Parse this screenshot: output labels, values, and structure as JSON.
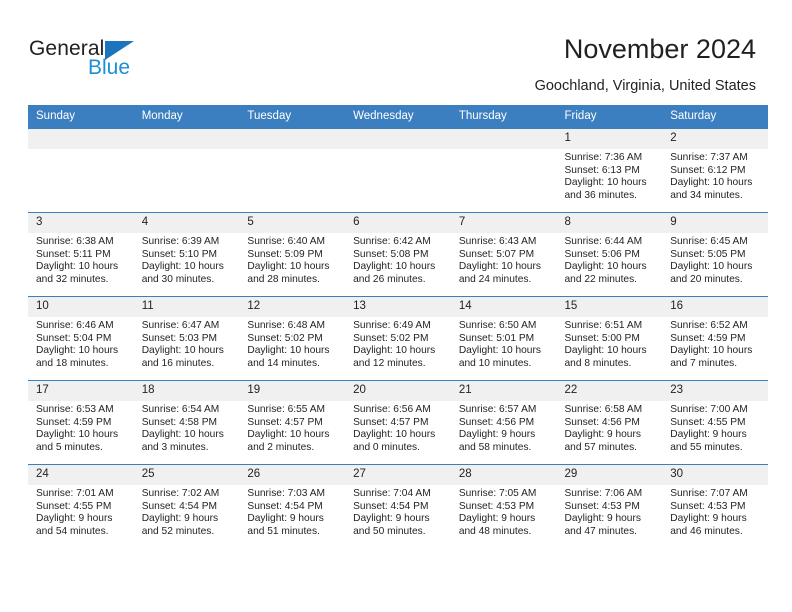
{
  "brand": {
    "name_part1": "General",
    "name_part2": "Blue",
    "triangle_color": "#1c75bc",
    "blue_color": "#1c8fd6"
  },
  "header": {
    "title": "November 2024",
    "subtitle": "Goochland, Virginia, United States",
    "accent_color": "#3c7fc0"
  },
  "calendar": {
    "weekdays": [
      "Sunday",
      "Monday",
      "Tuesday",
      "Wednesday",
      "Thursday",
      "Friday",
      "Saturday"
    ],
    "weeks": [
      [
        {
          "day": "",
          "sunrise": "",
          "sunset": "",
          "daylight": "",
          "blank": true
        },
        {
          "day": "",
          "sunrise": "",
          "sunset": "",
          "daylight": "",
          "blank": true
        },
        {
          "day": "",
          "sunrise": "",
          "sunset": "",
          "daylight": "",
          "blank": true
        },
        {
          "day": "",
          "sunrise": "",
          "sunset": "",
          "daylight": "",
          "blank": true
        },
        {
          "day": "",
          "sunrise": "",
          "sunset": "",
          "daylight": "",
          "blank": true
        },
        {
          "day": "1",
          "sunrise": "Sunrise: 7:36 AM",
          "sunset": "Sunset: 6:13 PM",
          "daylight": "Daylight: 10 hours and 36 minutes."
        },
        {
          "day": "2",
          "sunrise": "Sunrise: 7:37 AM",
          "sunset": "Sunset: 6:12 PM",
          "daylight": "Daylight: 10 hours and 34 minutes."
        }
      ],
      [
        {
          "day": "3",
          "sunrise": "Sunrise: 6:38 AM",
          "sunset": "Sunset: 5:11 PM",
          "daylight": "Daylight: 10 hours and 32 minutes."
        },
        {
          "day": "4",
          "sunrise": "Sunrise: 6:39 AM",
          "sunset": "Sunset: 5:10 PM",
          "daylight": "Daylight: 10 hours and 30 minutes."
        },
        {
          "day": "5",
          "sunrise": "Sunrise: 6:40 AM",
          "sunset": "Sunset: 5:09 PM",
          "daylight": "Daylight: 10 hours and 28 minutes."
        },
        {
          "day": "6",
          "sunrise": "Sunrise: 6:42 AM",
          "sunset": "Sunset: 5:08 PM",
          "daylight": "Daylight: 10 hours and 26 minutes."
        },
        {
          "day": "7",
          "sunrise": "Sunrise: 6:43 AM",
          "sunset": "Sunset: 5:07 PM",
          "daylight": "Daylight: 10 hours and 24 minutes."
        },
        {
          "day": "8",
          "sunrise": "Sunrise: 6:44 AM",
          "sunset": "Sunset: 5:06 PM",
          "daylight": "Daylight: 10 hours and 22 minutes."
        },
        {
          "day": "9",
          "sunrise": "Sunrise: 6:45 AM",
          "sunset": "Sunset: 5:05 PM",
          "daylight": "Daylight: 10 hours and 20 minutes."
        }
      ],
      [
        {
          "day": "10",
          "sunrise": "Sunrise: 6:46 AM",
          "sunset": "Sunset: 5:04 PM",
          "daylight": "Daylight: 10 hours and 18 minutes."
        },
        {
          "day": "11",
          "sunrise": "Sunrise: 6:47 AM",
          "sunset": "Sunset: 5:03 PM",
          "daylight": "Daylight: 10 hours and 16 minutes."
        },
        {
          "day": "12",
          "sunrise": "Sunrise: 6:48 AM",
          "sunset": "Sunset: 5:02 PM",
          "daylight": "Daylight: 10 hours and 14 minutes."
        },
        {
          "day": "13",
          "sunrise": "Sunrise: 6:49 AM",
          "sunset": "Sunset: 5:02 PM",
          "daylight": "Daylight: 10 hours and 12 minutes."
        },
        {
          "day": "14",
          "sunrise": "Sunrise: 6:50 AM",
          "sunset": "Sunset: 5:01 PM",
          "daylight": "Daylight: 10 hours and 10 minutes."
        },
        {
          "day": "15",
          "sunrise": "Sunrise: 6:51 AM",
          "sunset": "Sunset: 5:00 PM",
          "daylight": "Daylight: 10 hours and 8 minutes."
        },
        {
          "day": "16",
          "sunrise": "Sunrise: 6:52 AM",
          "sunset": "Sunset: 4:59 PM",
          "daylight": "Daylight: 10 hours and 7 minutes."
        }
      ],
      [
        {
          "day": "17",
          "sunrise": "Sunrise: 6:53 AM",
          "sunset": "Sunset: 4:59 PM",
          "daylight": "Daylight: 10 hours and 5 minutes."
        },
        {
          "day": "18",
          "sunrise": "Sunrise: 6:54 AM",
          "sunset": "Sunset: 4:58 PM",
          "daylight": "Daylight: 10 hours and 3 minutes."
        },
        {
          "day": "19",
          "sunrise": "Sunrise: 6:55 AM",
          "sunset": "Sunset: 4:57 PM",
          "daylight": "Daylight: 10 hours and 2 minutes."
        },
        {
          "day": "20",
          "sunrise": "Sunrise: 6:56 AM",
          "sunset": "Sunset: 4:57 PM",
          "daylight": "Daylight: 10 hours and 0 minutes."
        },
        {
          "day": "21",
          "sunrise": "Sunrise: 6:57 AM",
          "sunset": "Sunset: 4:56 PM",
          "daylight": "Daylight: 9 hours and 58 minutes."
        },
        {
          "day": "22",
          "sunrise": "Sunrise: 6:58 AM",
          "sunset": "Sunset: 4:56 PM",
          "daylight": "Daylight: 9 hours and 57 minutes."
        },
        {
          "day": "23",
          "sunrise": "Sunrise: 7:00 AM",
          "sunset": "Sunset: 4:55 PM",
          "daylight": "Daylight: 9 hours and 55 minutes."
        }
      ],
      [
        {
          "day": "24",
          "sunrise": "Sunrise: 7:01 AM",
          "sunset": "Sunset: 4:55 PM",
          "daylight": "Daylight: 9 hours and 54 minutes."
        },
        {
          "day": "25",
          "sunrise": "Sunrise: 7:02 AM",
          "sunset": "Sunset: 4:54 PM",
          "daylight": "Daylight: 9 hours and 52 minutes."
        },
        {
          "day": "26",
          "sunrise": "Sunrise: 7:03 AM",
          "sunset": "Sunset: 4:54 PM",
          "daylight": "Daylight: 9 hours and 51 minutes."
        },
        {
          "day": "27",
          "sunrise": "Sunrise: 7:04 AM",
          "sunset": "Sunset: 4:54 PM",
          "daylight": "Daylight: 9 hours and 50 minutes."
        },
        {
          "day": "28",
          "sunrise": "Sunrise: 7:05 AM",
          "sunset": "Sunset: 4:53 PM",
          "daylight": "Daylight: 9 hours and 48 minutes."
        },
        {
          "day": "29",
          "sunrise": "Sunrise: 7:06 AM",
          "sunset": "Sunset: 4:53 PM",
          "daylight": "Daylight: 9 hours and 47 minutes."
        },
        {
          "day": "30",
          "sunrise": "Sunrise: 7:07 AM",
          "sunset": "Sunset: 4:53 PM",
          "daylight": "Daylight: 9 hours and 46 minutes."
        }
      ]
    ]
  }
}
